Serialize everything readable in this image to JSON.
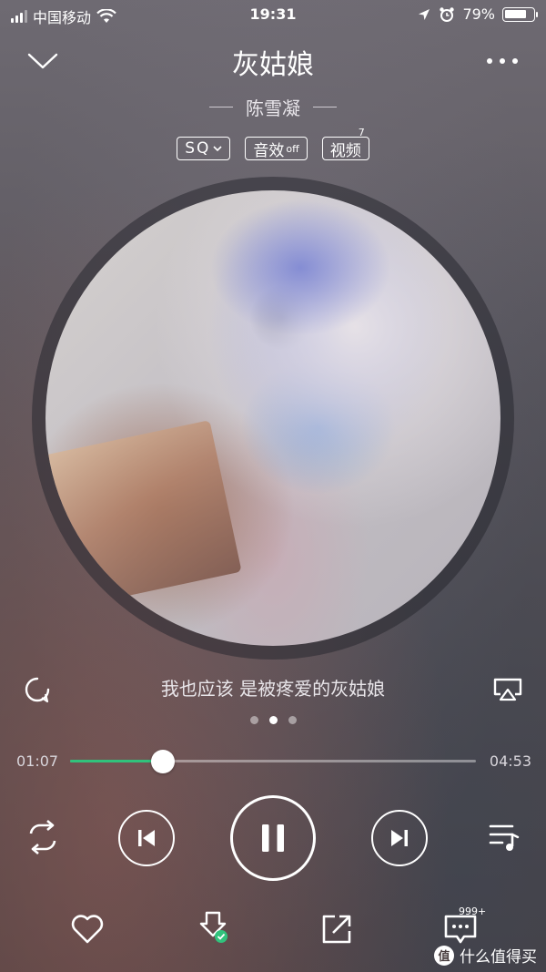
{
  "status_bar": {
    "carrier": "中国移动",
    "time": "19:31",
    "battery_percent": "79%",
    "battery_level": 0.79,
    "icons": [
      "signal-bars-icon",
      "wifi-icon",
      "location-arrow-icon",
      "alarm-clock-icon",
      "battery-icon"
    ]
  },
  "header": {
    "collapse_icon": "chevron-down-icon",
    "song_title": "灰姑娘",
    "more_icon": "more-dots-icon"
  },
  "artist": "陈雪凝",
  "tags": {
    "quality": "SQ",
    "effect_label": "音效",
    "effect_state": "off",
    "video_label": "视频",
    "video_count": "7"
  },
  "cover": {
    "description_icon": "album-cover"
  },
  "lyric_line": "我也应该 是被疼爱的灰姑娘",
  "lyric_bar": {
    "left_icon": "lyric-poster-icon",
    "right_icon": "airplay-icon"
  },
  "pager": {
    "count": 3,
    "active_index": 1
  },
  "progress": {
    "current_time": "01:07",
    "total_time": "04:53",
    "fraction": 0.228,
    "accent_color": "#31c27c"
  },
  "controls": {
    "repeat_icon": "repeat-icon",
    "prev_icon": "previous-track-icon",
    "pause_icon": "pause-icon",
    "next_icon": "next-track-icon",
    "playlist_icon": "playlist-icon"
  },
  "bottom_bar": {
    "favorite_icon": "heart-icon",
    "download_icon": "download-done-icon",
    "share_icon": "share-icon",
    "comment_icon": "comment-icon",
    "comment_count": "999+"
  },
  "watermark": "值 什么值得买"
}
